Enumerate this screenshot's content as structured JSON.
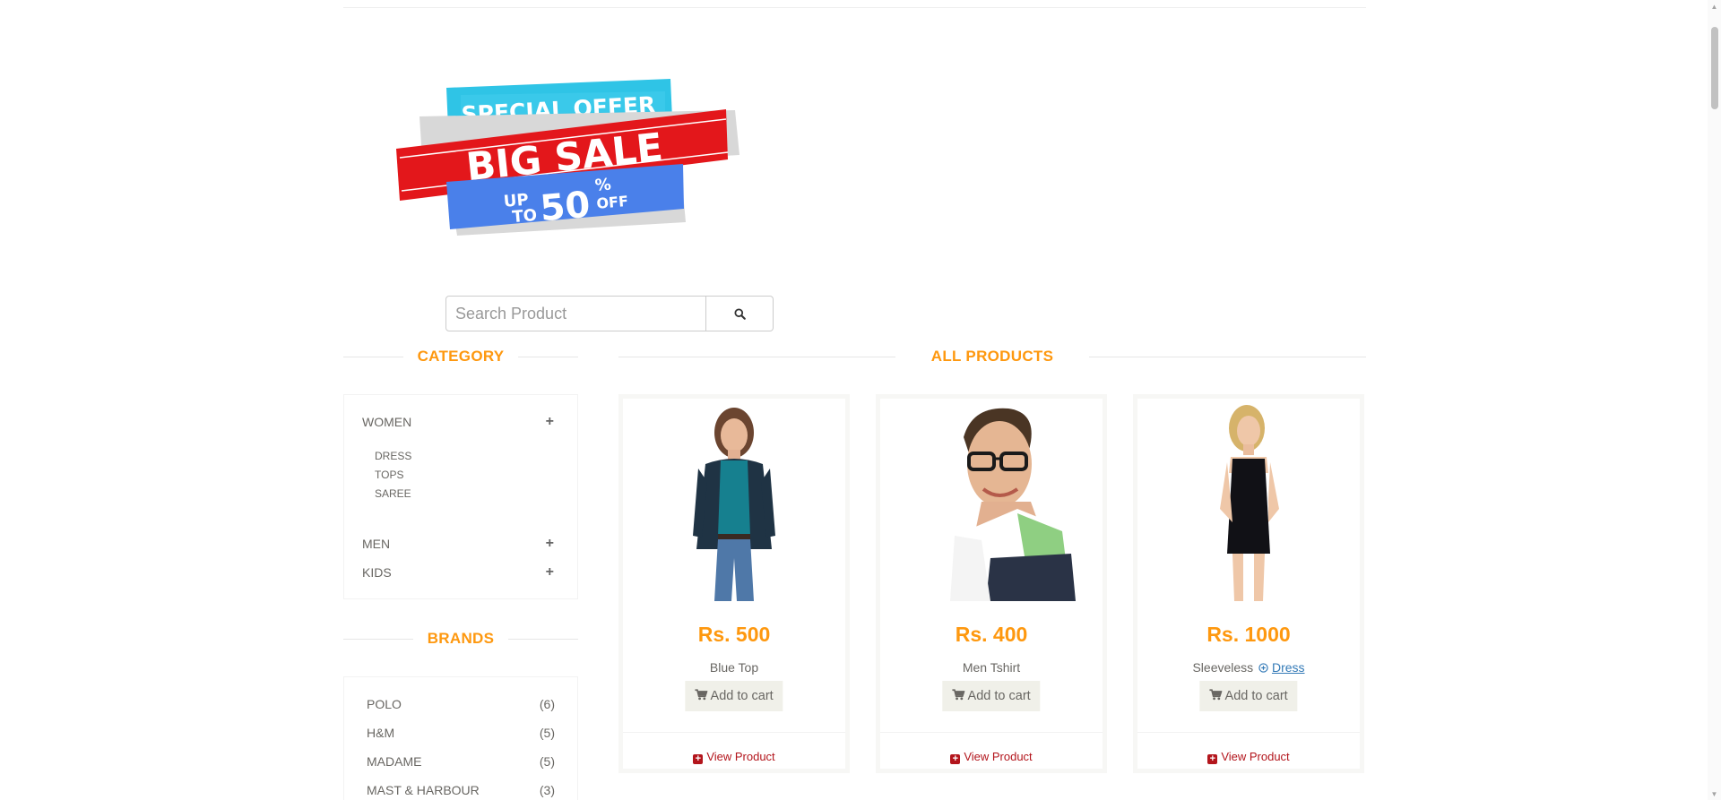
{
  "banner": {
    "line1": "SPECIAL OFFER",
    "line2": "BIG SALE",
    "line3_up": "UP",
    "line3_to": "TO",
    "line3_num": "50",
    "line3_pct": "%",
    "line3_off": "OFF"
  },
  "search": {
    "placeholder": "Search Product"
  },
  "category": {
    "title": "CATEGORY",
    "items": [
      {
        "label": "WOMEN",
        "subs": [
          "DRESS",
          "TOPS",
          "SAREE"
        ]
      },
      {
        "label": "MEN"
      },
      {
        "label": "KIDS"
      }
    ]
  },
  "brands": {
    "title": "BRANDS",
    "items": [
      {
        "name": "POLO",
        "count": "(6)"
      },
      {
        "name": "H&M",
        "count": "(5)"
      },
      {
        "name": "MADAME",
        "count": "(5)"
      },
      {
        "name": "MAST & HARBOUR",
        "count": "(3)"
      }
    ]
  },
  "products": {
    "title": "ALL PRODUCTS",
    "items": [
      {
        "price": "Rs. 500",
        "name": "Blue Top",
        "cart": "Add to cart",
        "view": "View Product"
      },
      {
        "price": "Rs. 400",
        "name": "Men Tshirt",
        "cart": "Add to cart",
        "view": "View Product"
      },
      {
        "price": "Rs. 1000",
        "name": "Sleeveless",
        "link": "Dress",
        "cart": "Add to cart",
        "view": "View Product"
      }
    ]
  },
  "colors": {
    "accent": "#FE980F",
    "view_red": "#B3151C",
    "button_bg": "#F0F0E9"
  }
}
